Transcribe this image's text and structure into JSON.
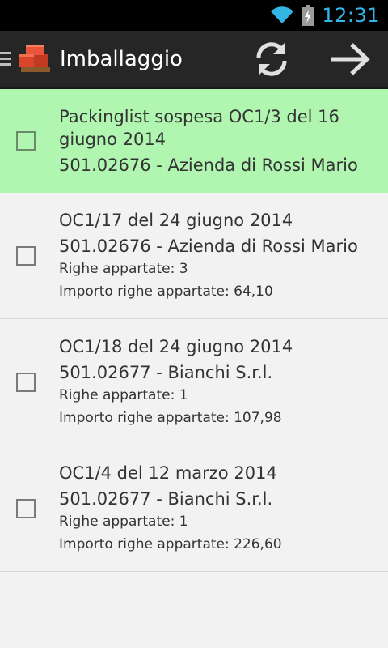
{
  "status_bar": {
    "time": "12:31",
    "icons": [
      "wifi-icon",
      "battery-charging-icon"
    ]
  },
  "action_bar": {
    "title": "Imballaggio",
    "icons": [
      "menu-icon",
      "boxes-logo-icon",
      "refresh-icon",
      "arrow-right-icon"
    ]
  },
  "list": {
    "items": [
      {
        "title": "Packinglist sospesa OC1/3 del 16 giugno 2014",
        "subtitle": "501.02676 - Azienda di Rossi Mario",
        "selected_background": "#b0f5b0"
      },
      {
        "title": "OC1/17 del 24 giugno 2014",
        "subtitle": "501.02676 - Azienda di Rossi Mario",
        "rows": "Righe appartate: 3",
        "amount": "Importo righe appartate: 64,10"
      },
      {
        "title": "OC1/18 del 24 giugno 2014",
        "subtitle": "501.02677 - Bianchi S.r.l.",
        "rows": "Righe appartate: 1",
        "amount": "Importo righe appartate: 107,98"
      },
      {
        "title": "OC1/4 del 12 marzo 2014",
        "subtitle": "501.02677 - Bianchi S.r.l.",
        "rows": "Righe appartate: 1",
        "amount": "Importo righe appartate: 226,60"
      }
    ]
  },
  "colors": {
    "accent": "#33b5e5",
    "selected_row": "#b0f5b0",
    "action_bar": "#262626"
  }
}
